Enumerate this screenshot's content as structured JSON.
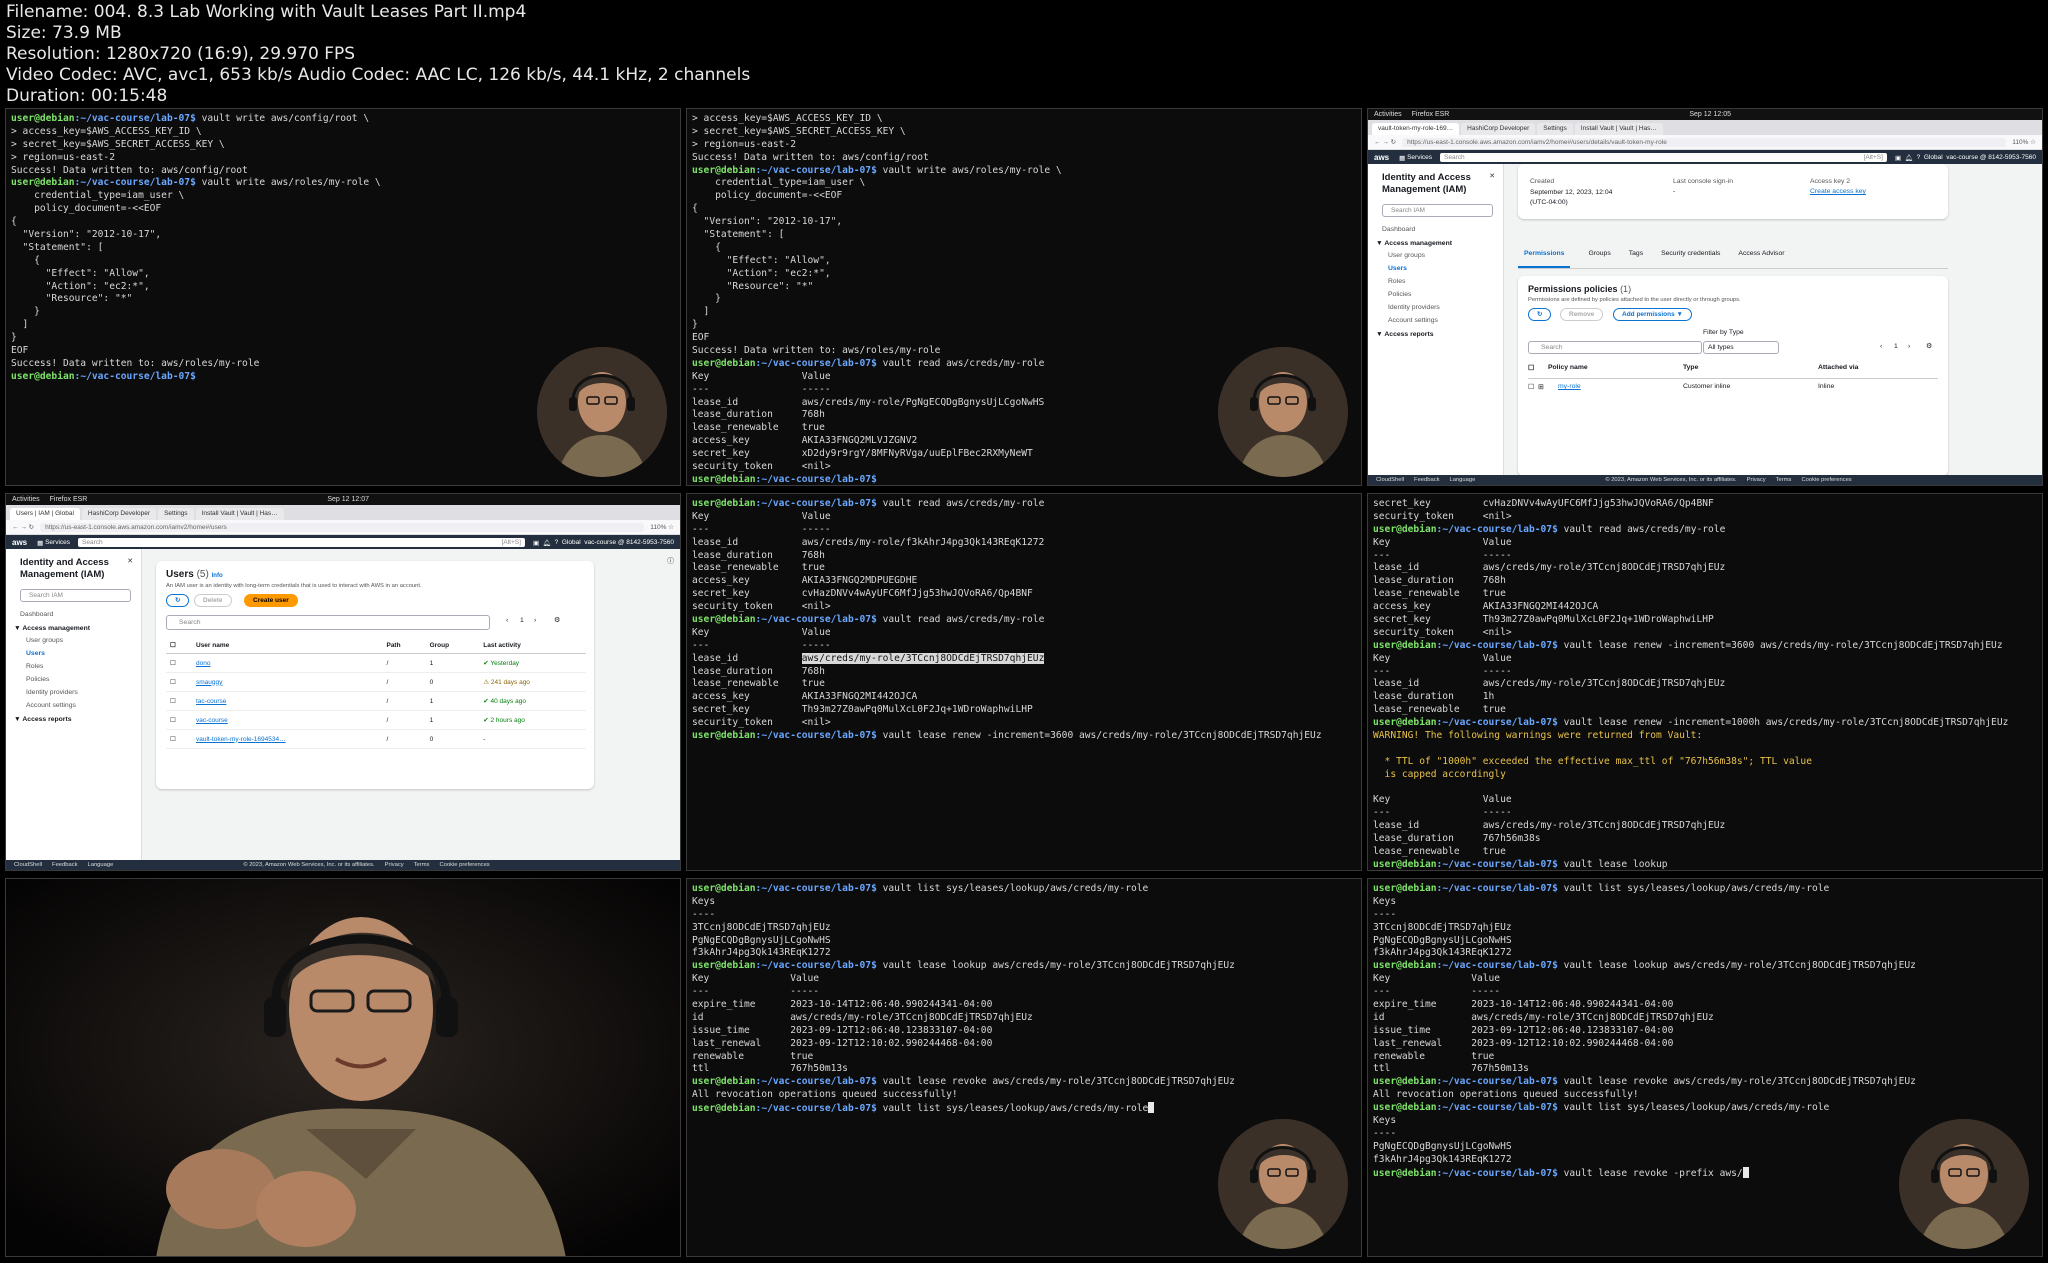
{
  "header": {
    "filename": "Filename: 004. 8.3 Lab Working with Vault Leases Part II.mp4",
    "size": "Size: 73.9 MB",
    "resolution": "Resolution: 1280x720 (16:9), 29.970 FPS",
    "codec": "Video Codec: AVC, avc1, 653 kb/s Audio Codec: AAC LC, 126 kb/s, 44.1 kHz, 2 channels",
    "duration": "Duration: 00:15:48"
  },
  "prompt": {
    "user": "user@debian",
    "path": ":~/vac-course/lab-07$"
  },
  "term1": [
    {
      "cmd": " vault write aws/config/root \\"
    },
    {
      "t": "> access_key=$AWS_ACCESS_KEY_ID \\"
    },
    {
      "t": "> secret_key=$AWS_SECRET_ACCESS_KEY \\"
    },
    {
      "t": "> region=us-east-2"
    },
    {
      "t": "Success! Data written to: aws/config/root"
    },
    {
      "cmd": " vault write aws/roles/my-role \\"
    },
    {
      "t": "    credential_type=iam_user \\"
    },
    {
      "t": "    policy_document=-<<EOF"
    },
    {
      "t": "{"
    },
    {
      "t": "  \"Version\": \"2012-10-17\","
    },
    {
      "t": "  \"Statement\": ["
    },
    {
      "t": "    {"
    },
    {
      "t": "      \"Effect\": \"Allow\","
    },
    {
      "t": "      \"Action\": \"ec2:*\","
    },
    {
      "t": "      \"Resource\": \"*\""
    },
    {
      "t": "    }"
    },
    {
      "t": "  ]"
    },
    {
      "t": "}"
    },
    {
      "t": "EOF"
    },
    {
      "t": "Success! Data written to: aws/roles/my-role"
    },
    {
      "cmd": " "
    }
  ],
  "term2": [
    {
      "t": "> access_key=$AWS_ACCESS_KEY_ID \\"
    },
    {
      "t": "> secret_key=$AWS_SECRET_ACCESS_KEY \\"
    },
    {
      "t": "> region=us-east-2"
    },
    {
      "t": "Success! Data written to: aws/config/root"
    },
    {
      "cmd": " vault write aws/roles/my-role \\"
    },
    {
      "t": "    credential_type=iam_user \\"
    },
    {
      "t": "    policy_document=-<<EOF"
    },
    {
      "t": "{"
    },
    {
      "t": "  \"Version\": \"2012-10-17\","
    },
    {
      "t": "  \"Statement\": ["
    },
    {
      "t": "    {"
    },
    {
      "t": "      \"Effect\": \"Allow\","
    },
    {
      "t": "      \"Action\": \"ec2:*\","
    },
    {
      "t": "      \"Resource\": \"*\""
    },
    {
      "t": "    }"
    },
    {
      "t": "  ]"
    },
    {
      "t": "}"
    },
    {
      "t": "EOF"
    },
    {
      "t": "Success! Data written to: aws/roles/my-role"
    },
    {
      "cmd": " vault read aws/creds/my-role"
    },
    {
      "t": "Key                Value"
    },
    {
      "t": "---                -----"
    },
    {
      "t": "lease_id           aws/creds/my-role/PgNgECQDgBgnysUjLCgoNwHS"
    },
    {
      "t": "lease_duration     768h"
    },
    {
      "t": "lease_renewable    true"
    },
    {
      "t": "access_key         AKIA33FNGQ2MLVJZGNV2"
    },
    {
      "t": "secret_key         xD2dy9r9rgY/8MFNyRVga/uuEplFBec2RXMyNeWT"
    },
    {
      "t": "security_token     <nil>"
    },
    {
      "cmd": " "
    }
  ],
  "term4": [
    {
      "cmd": " vault read aws/creds/my-role"
    },
    {
      "t": "Key                Value"
    },
    {
      "t": "---                -----"
    },
    {
      "t": "lease_id           aws/creds/my-role/f3kAhrJ4pg3Qk143REqK1272"
    },
    {
      "t": "lease_duration     768h"
    },
    {
      "t": "lease_renewable    true"
    },
    {
      "t": "access_key         AKIA33FNGQ2MDPUEGDHE"
    },
    {
      "t": "secret_key         cvHazDNVv4wAyUFC6MfJjg53hwJQVoRA6/Qp4BNF"
    },
    {
      "t": "security_token     <nil>"
    },
    {
      "cmd": " vault read aws/creds/my-role"
    },
    {
      "t": "Key                Value"
    },
    {
      "t": "---                -----"
    },
    {
      "pre": "lease_id           ",
      "hl": "aws/creds/my-role/3TCcnj8ODCdEjTRSD7qhjEUz"
    },
    {
      "t": "lease_duration     768h"
    },
    {
      "t": "lease_renewable    true"
    },
    {
      "t": "access_key         AKIA33FNGQ2MI442OJCA"
    },
    {
      "t": "secret_key         Th93m27Z0awPq0MulXcL0F2Jq+1WDroWaphwiLHP"
    },
    {
      "t": "security_token     <nil>"
    },
    {
      "cmd": " vault lease renew -increment=3600 aws/creds/my-role/3TCcnj8ODCdEjTRSD7qhjEUz"
    }
  ],
  "term5": [
    {
      "t": "secret_key         cvHazDNVv4wAyUFC6MfJjg53hwJQVoRA6/Qp4BNF"
    },
    {
      "t": "security_token     <nil>"
    },
    {
      "cmd": " vault read aws/creds/my-role"
    },
    {
      "t": "Key                Value"
    },
    {
      "t": "---                -----"
    },
    {
      "t": "lease_id           aws/creds/my-role/3TCcnj8ODCdEjTRSD7qhjEUz"
    },
    {
      "t": "lease_duration     768h"
    },
    {
      "t": "lease_renewable    true"
    },
    {
      "t": "access_key         AKIA33FNGQ2MI442OJCA"
    },
    {
      "t": "secret_key         Th93m27Z0awPq0MulXcL0F2Jq+1WDroWaphwiLHP"
    },
    {
      "t": "security_token     <nil>"
    },
    {
      "cmd": " vault lease renew -increment=3600 aws/creds/my-role/3TCcnj8ODCdEjTRSD7qhjEUz"
    },
    {
      "t": "Key                Value"
    },
    {
      "t": "---                -----"
    },
    {
      "t": "lease_id           aws/creds/my-role/3TCcnj8ODCdEjTRSD7qhjEUz"
    },
    {
      "t": "lease_duration     1h"
    },
    {
      "t": "lease_renewable    true"
    },
    {
      "cmd": " vault lease renew -increment=1000h aws/creds/my-role/3TCcnj8ODCdEjTRSD7qhjEUz"
    },
    {
      "w": "WARNING! The following warnings were returned from Vault:"
    },
    {
      "t": ""
    },
    {
      "w": "  * TTL of \"1000h\" exceeded the effective max_ttl of \"767h56m38s\"; TTL value"
    },
    {
      "w": "  is capped accordingly"
    },
    {
      "t": ""
    },
    {
      "t": "Key                Value"
    },
    {
      "t": "---                -----"
    },
    {
      "t": "lease_id           aws/creds/my-role/3TCcnj8ODCdEjTRSD7qhjEUz"
    },
    {
      "t": "lease_duration     767h56m38s"
    },
    {
      "t": "lease_renewable    true"
    },
    {
      "cmd": " vault lease lookup"
    }
  ],
  "term7": [
    {
      "cmd": " vault list sys/leases/lookup/aws/creds/my-role"
    },
    {
      "t": "Keys"
    },
    {
      "t": "----"
    },
    {
      "t": "3TCcnj8ODCdEjTRSD7qhjEUz"
    },
    {
      "t": "PgNgECQDgBgnysUjLCgoNwHS"
    },
    {
      "t": "f3kAhrJ4pg3Qk143REqK1272"
    },
    {
      "cmd": " vault lease lookup aws/creds/my-role/3TCcnj8ODCdEjTRSD7qhjEUz"
    },
    {
      "t": "Key              Value"
    },
    {
      "t": "---              -----"
    },
    {
      "t": "expire_time      2023-10-14T12:06:40.990244341-04:00"
    },
    {
      "t": "id               aws/creds/my-role/3TCcnj8ODCdEjTRSD7qhjEUz"
    },
    {
      "t": "issue_time       2023-09-12T12:06:40.123833107-04:00"
    },
    {
      "t": "last_renewal     2023-09-12T12:10:02.990244468-04:00"
    },
    {
      "t": "renewable        true"
    },
    {
      "t": "ttl              767h50m13s"
    },
    {
      "cmd": " vault lease revoke aws/creds/my-role/3TCcnj8ODCdEjTRSD7qhjEUz"
    },
    {
      "t": "All revocation operations queued successfully!"
    },
    {
      "cmd": " vault list sys/leases/lookup/aws/creds/my-role",
      "cursor": true
    }
  ],
  "term8": [
    {
      "cmd": " vault list sys/leases/lookup/aws/creds/my-role"
    },
    {
      "t": "Keys"
    },
    {
      "t": "----"
    },
    {
      "t": "3TCcnj8ODCdEjTRSD7qhjEUz"
    },
    {
      "t": "PgNgECQDgBgnysUjLCgoNwHS"
    },
    {
      "t": "f3kAhrJ4pg3Qk143REqK1272"
    },
    {
      "cmd": " vault lease lookup aws/creds/my-role/3TCcnj8ODCdEjTRSD7qhjEUz"
    },
    {
      "t": "Key              Value"
    },
    {
      "t": "---              -----"
    },
    {
      "t": "expire_time      2023-10-14T12:06:40.990244341-04:00"
    },
    {
      "t": "id               aws/creds/my-role/3TCcnj8ODCdEjTRSD7qhjEUz"
    },
    {
      "t": "issue_time       2023-09-12T12:06:40.123833107-04:00"
    },
    {
      "t": "last_renewal     2023-09-12T12:10:02.990244468-04:00"
    },
    {
      "t": "renewable        true"
    },
    {
      "t": "ttl              767h50m13s"
    },
    {
      "cmd": " vault lease revoke aws/creds/my-role/3TCcnj8ODCdEjTRSD7qhjEUz"
    },
    {
      "t": "All revocation operations queued successfully!"
    },
    {
      "cmd": " vault list sys/leases/lookup/aws/creds/my-role"
    },
    {
      "t": "Keys"
    },
    {
      "t": "----"
    },
    {
      "t": "PgNgECQDgBgnysUjLCgoNwHS"
    },
    {
      "t": "f3kAhrJ4pg3Qk143REqK1272"
    },
    {
      "cmd": " vault lease revoke -prefix aws/",
      "cursor": true
    }
  ],
  "browser_top": {
    "activities": "Activities",
    "app": "Firefox ESR",
    "clock": "Sep 12 12:05",
    "tabs": [
      "vault-token-my-role-169…",
      "HashiCorp Developer",
      "Settings",
      "Install Vault | Vault | Has…"
    ],
    "url": "https://us-east-1.console.aws.amazon.com/iamv2/home#/users/details/vault-token-my-role",
    "zoom": "110%",
    "aws_services": "Services",
    "aws_search": "Search",
    "aws_shortcut": "[Alt+S]",
    "region": "Global",
    "account": "vac-course @ 8142-5953-7560",
    "sidebar_title": "Identity and Access Management (IAM)",
    "sidebar_search": "Search IAM",
    "sidebar_dashboard": "Dashboard",
    "sidebar_access_mgmt": "Access management",
    "sidebar_items": [
      "User groups",
      "Users",
      "Roles",
      "Policies",
      "Identity providers",
      "Account settings"
    ],
    "sidebar_reports": "Access reports",
    "summary": [
      {
        "label": "Created",
        "value": "September 12, 2023, 12:04 (UTC-04:00)"
      },
      {
        "label": "Last console sign-in",
        "value": "-"
      },
      {
        "label": "Access key 2",
        "value": "Create access key"
      }
    ],
    "tabs_inner": [
      "Permissions",
      "Groups",
      "Tags",
      "Security credentials",
      "Access Advisor"
    ],
    "perm_title": "Permissions policies",
    "perm_count": "(1)",
    "perm_desc": "Permissions are defined by policies attached to the user directly or through groups.",
    "remove": "Remove",
    "add_perm": "Add permissions ▼",
    "filter_label": "Filter by Type",
    "filter_value": "All types",
    "search": "Search",
    "page": "1",
    "col_policy": "Policy name",
    "col_type": "Type",
    "col_attached": "Attached via",
    "row_policy": "my-role",
    "row_type": "Customer inline",
    "row_attached": "Inline",
    "footer": [
      "CloudShell",
      "Feedback",
      "Language"
    ],
    "footer_right": "© 2023, Amazon Web Services, Inc. or its affiliates.",
    "footer_links": [
      "Privacy",
      "Terms",
      "Cookie preferences"
    ]
  },
  "browser_mid": {
    "activities": "Activities",
    "app": "Firefox ESR",
    "clock": "Sep 12 12:07",
    "tabs": [
      "Users | IAM | Global",
      "HashiCorp Developer",
      "Settings",
      "Install Vault | Vault | Has…"
    ],
    "url": "https://us-east-1.console.aws.amazon.com/iamv2/home#/users",
    "zoom": "110%",
    "aws_services": "Services",
    "aws_search": "Search",
    "aws_shortcut": "[Alt+S]",
    "region": "Global",
    "account": "vac-course @ 8142-5953-7560",
    "sidebar_title": "Identity and Access Management (IAM)",
    "sidebar_search": "Search IAM",
    "sidebar_dashboard": "Dashboard",
    "sidebar_access_mgmt": "Access management",
    "sidebar_items": [
      "User groups",
      "Users",
      "Roles",
      "Policies",
      "Identity providers",
      "Account settings"
    ],
    "sidebar_reports": "Access reports",
    "users_title": "Users",
    "users_count": "(5)",
    "users_info": "Info",
    "users_desc": "An IAM user is an identity with long-term credentials that is used to interact with AWS in an account.",
    "delete": "Delete",
    "create": "Create user",
    "search": "Search",
    "page": "1",
    "cols": [
      "User name",
      "Path",
      "Group",
      "Last activity"
    ],
    "rows": [
      {
        "name": "dono",
        "path": "/",
        "group": "1",
        "activity": "Yesterday",
        "status": "ok"
      },
      {
        "name": "smauggy",
        "path": "/",
        "group": "0",
        "activity": "241 days ago",
        "status": "warn"
      },
      {
        "name": "tac-course",
        "path": "/",
        "group": "1",
        "activity": "40 days ago",
        "status": "ok"
      },
      {
        "name": "vac-course",
        "path": "/",
        "group": "1",
        "activity": "2 hours ago",
        "status": "ok"
      },
      {
        "name": "vault-token-my-role-1694534…",
        "path": "/",
        "group": "0",
        "activity": "-",
        "status": "none"
      }
    ],
    "footer": [
      "CloudShell",
      "Feedback",
      "Language"
    ],
    "footer_right": "© 2023, Amazon Web Services, Inc. or its affiliates.",
    "footer_links": [
      "Privacy",
      "Terms",
      "Cookie preferences"
    ]
  }
}
